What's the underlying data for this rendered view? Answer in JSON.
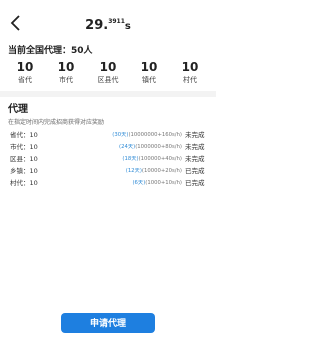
{
  "header": {
    "timer_main": "29.",
    "timer_fraction": "3911",
    "timer_unit": "s"
  },
  "current": {
    "label": "当前全国代理：",
    "value": "50人"
  },
  "stats": [
    {
      "value": "10",
      "label": "省代"
    },
    {
      "value": "10",
      "label": "市代"
    },
    {
      "value": "10",
      "label": "区县代"
    },
    {
      "value": "10",
      "label": "镇代"
    },
    {
      "value": "10",
      "label": "村代"
    }
  ],
  "agent_section": {
    "title": "代理",
    "description": "在指定时间内完成招商获得对应奖励",
    "rows": [
      {
        "label": "省代：10",
        "days": "(30天)",
        "reward": "(10000000+160s/h)",
        "status": "未完成"
      },
      {
        "label": "市代：10",
        "days": "(24天)",
        "reward": "(1000000+80s/h)",
        "status": "未完成"
      },
      {
        "label": "区县：10",
        "days": "(18天)",
        "reward": "(100000+40s/h)",
        "status": "未完成"
      },
      {
        "label": "乡镇：10",
        "days": "(12天)",
        "reward": "(10000+20s/h)",
        "status": "已完成"
      },
      {
        "label": "村代：10",
        "days": "(6天)",
        "reward": "(1000+10s/h)",
        "status": "已完成"
      }
    ]
  },
  "apply_button": "申请代理",
  "colors": {
    "accent": "#1e7fe0",
    "days_text": "#2f8bd6"
  }
}
